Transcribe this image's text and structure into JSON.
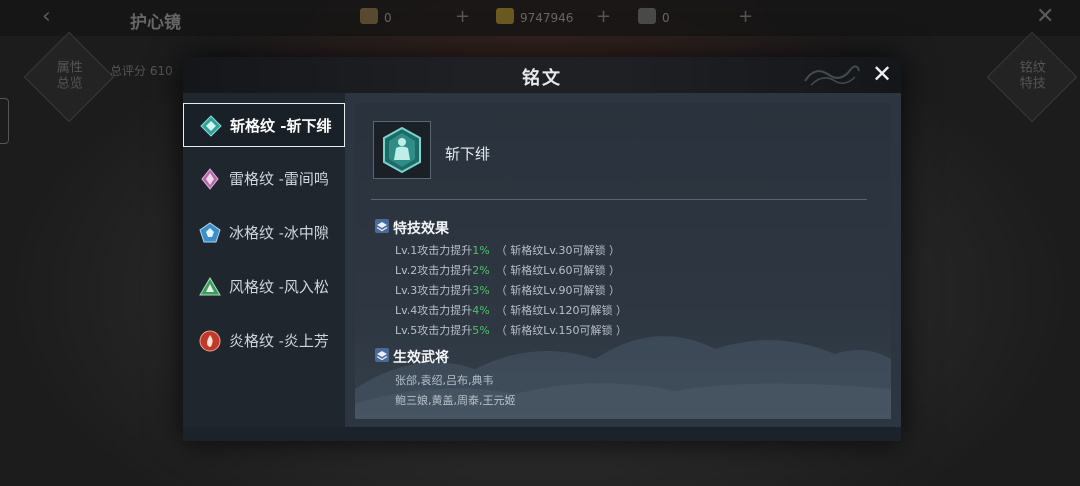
{
  "background": {
    "page_title": "护心镜",
    "resources": [
      {
        "name": "book",
        "value": "0"
      },
      {
        "name": "gold",
        "value": "9747946"
      },
      {
        "name": "ingot",
        "value": "0"
      }
    ],
    "left_button": "属性\n总览",
    "right_button": "铭纹\n特技",
    "score_label": "总评分  610"
  },
  "modal": {
    "title": "铭文",
    "tabs": [
      {
        "label": "斩格纹 -斩下绯",
        "icon": "slash-gem-icon",
        "color": "#3fb8b0",
        "active": true
      },
      {
        "label": "雷格纹 -雷间鸣",
        "icon": "thunder-gem-icon",
        "color": "#c77ac0",
        "active": false
      },
      {
        "label": "冰格纹 -冰中隙",
        "icon": "ice-gem-icon",
        "color": "#4aa3d8",
        "active": false
      },
      {
        "label": "风格纹 -风入松",
        "icon": "wind-gem-icon",
        "color": "#4cb070",
        "active": false
      },
      {
        "label": "炎格纹 -炎上芳",
        "icon": "fire-gem-icon",
        "color": "#d84a3a",
        "active": false
      }
    ],
    "detail": {
      "item_name": "斩下绯",
      "effects_title": "特技效果",
      "effects": [
        {
          "text": "Lv.1攻击力提升",
          "pct": "1%",
          "note": "（ 斩格纹Lv.30可解锁 ）"
        },
        {
          "text": "Lv.2攻击力提升",
          "pct": "2%",
          "note": "（ 斩格纹Lv.60可解锁 ）"
        },
        {
          "text": "Lv.3攻击力提升",
          "pct": "3%",
          "note": "（ 斩格纹Lv.90可解锁 ）"
        },
        {
          "text": "Lv.4攻击力提升",
          "pct": "4%",
          "note": "（ 斩格纹Lv.120可解锁 ）"
        },
        {
          "text": "Lv.5攻击力提升",
          "pct": "5%",
          "note": "（ 斩格纹Lv.150可解锁 ）"
        }
      ],
      "generals_title": "生效武将",
      "generals": [
        "张郃,袁绍,吕布,典韦",
        "鲍三娘,黄盖,周泰,王元姬"
      ]
    }
  },
  "colors": {
    "accent_green": "#4fc06a",
    "panel_bg": "#252d36"
  }
}
